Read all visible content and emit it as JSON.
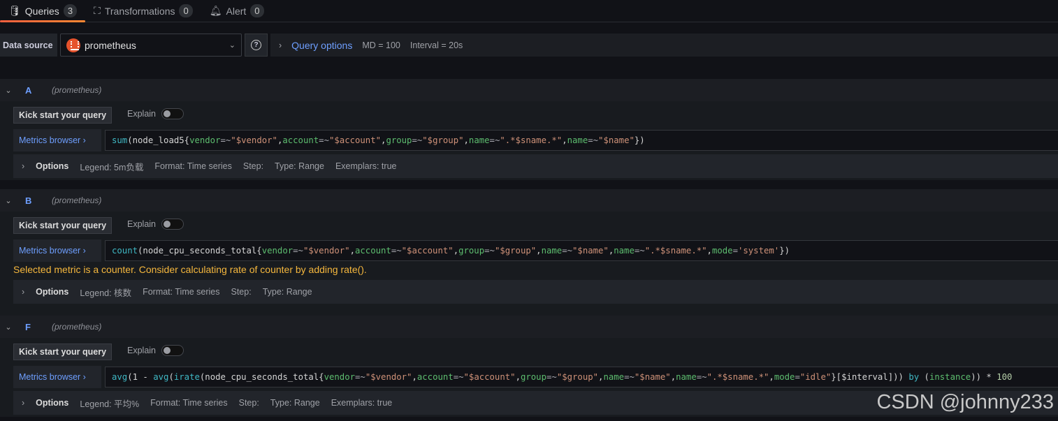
{
  "tabs": [
    {
      "label": "Queries",
      "count": "3",
      "icon": "database-icon"
    },
    {
      "label": "Transformations",
      "count": "0",
      "icon": "transform-icon"
    },
    {
      "label": "Alert",
      "count": "0",
      "icon": "bell-icon"
    }
  ],
  "datasource": {
    "label": "Data source",
    "value": "prometheus",
    "query_options": "Query options",
    "md": "MD = 100",
    "interval": "Interval = 20s"
  },
  "common": {
    "kick": "Kick start your query",
    "explain": "Explain",
    "metrics_browser": "Metrics browser ›",
    "options": "Options"
  },
  "queries": [
    {
      "letter": "A",
      "ds": "(prometheus)",
      "tokens": [
        [
          "sum",
          "f"
        ],
        [
          "(node_load5{",
          "p"
        ],
        [
          "vendor",
          "l"
        ],
        [
          "=~",
          "o"
        ],
        [
          "\"$vendor\"",
          "s"
        ],
        [
          ",",
          "p"
        ],
        [
          "account",
          "l"
        ],
        [
          "=~",
          "o"
        ],
        [
          "\"$account\"",
          "s"
        ],
        [
          ",",
          "p"
        ],
        [
          "group",
          "l"
        ],
        [
          "=~",
          "o"
        ],
        [
          "\"$group\"",
          "s"
        ],
        [
          ",",
          "p"
        ],
        [
          "name",
          "l"
        ],
        [
          "=~",
          "o"
        ],
        [
          "\".*$sname.*\"",
          "s"
        ],
        [
          ",",
          "p"
        ],
        [
          "name",
          "l"
        ],
        [
          "=~",
          "o"
        ],
        [
          "\"$name\"",
          "s"
        ],
        [
          "})",
          "p"
        ]
      ],
      "legend": "Legend: 5m负载",
      "format": "Format: Time series",
      "step": "Step:",
      "type": "Type: Range",
      "exemplars": "Exemplars: true"
    },
    {
      "letter": "B",
      "ds": "(prometheus)",
      "tokens": [
        [
          "count",
          "f"
        ],
        [
          "(node_cpu_seconds_total{",
          "p"
        ],
        [
          "vendor",
          "l"
        ],
        [
          "=~",
          "o"
        ],
        [
          "\"$vendor\"",
          "s"
        ],
        [
          ",",
          "p"
        ],
        [
          "account",
          "l"
        ],
        [
          "=~",
          "o"
        ],
        [
          "\"$account\"",
          "s"
        ],
        [
          ",",
          "p"
        ],
        [
          "group",
          "l"
        ],
        [
          "=~",
          "o"
        ],
        [
          "\"$group\"",
          "s"
        ],
        [
          ",",
          "p"
        ],
        [
          "name",
          "l"
        ],
        [
          "=~",
          "o"
        ],
        [
          "\"$name\"",
          "s"
        ],
        [
          ",",
          "p"
        ],
        [
          "name",
          "l"
        ],
        [
          "=~",
          "o"
        ],
        [
          "\".*$sname.*\"",
          "s"
        ],
        [
          ",",
          "p"
        ],
        [
          "mode",
          "l"
        ],
        [
          "=",
          "o"
        ],
        [
          "'system'",
          "s"
        ],
        [
          "})",
          "p"
        ]
      ],
      "warning": "Selected metric is a counter. Consider calculating rate of counter by adding rate().",
      "legend": "Legend: 核数",
      "format": "Format: Time series",
      "step": "Step:",
      "type": "Type: Range"
    },
    {
      "letter": "F",
      "ds": "(prometheus)",
      "tokens": [
        [
          "avg",
          "f"
        ],
        [
          "(1 - ",
          "p"
        ],
        [
          "avg",
          "f"
        ],
        [
          "(",
          "p"
        ],
        [
          "irate",
          "f"
        ],
        [
          "(node_cpu_seconds_total{",
          "p"
        ],
        [
          "vendor",
          "l"
        ],
        [
          "=~",
          "o"
        ],
        [
          "\"$vendor\"",
          "s"
        ],
        [
          ",",
          "p"
        ],
        [
          "account",
          "l"
        ],
        [
          "=~",
          "o"
        ],
        [
          "\"$account\"",
          "s"
        ],
        [
          ",",
          "p"
        ],
        [
          "group",
          "l"
        ],
        [
          "=~",
          "o"
        ],
        [
          "\"$group\"",
          "s"
        ],
        [
          ",",
          "p"
        ],
        [
          "name",
          "l"
        ],
        [
          "=~",
          "o"
        ],
        [
          "\"$name\"",
          "s"
        ],
        [
          ",",
          "p"
        ],
        [
          "name",
          "l"
        ],
        [
          "=~",
          "o"
        ],
        [
          "\".*$sname.*\"",
          "s"
        ],
        [
          ",",
          "p"
        ],
        [
          "mode",
          "l"
        ],
        [
          "=",
          "o"
        ],
        [
          "\"idle\"",
          "s"
        ],
        [
          "}[$interval])) ",
          "p"
        ],
        [
          "by",
          "f"
        ],
        [
          " (",
          "p"
        ],
        [
          "instance",
          "l"
        ],
        [
          ")) * ",
          "p"
        ],
        [
          "100",
          "n"
        ]
      ],
      "legend": "Legend: 平均%",
      "format": "Format: Time series",
      "step": "Step:",
      "type": "Type: Range",
      "exemplars": "Exemplars: true"
    }
  ],
  "watermark": "CSDN @johnny233"
}
